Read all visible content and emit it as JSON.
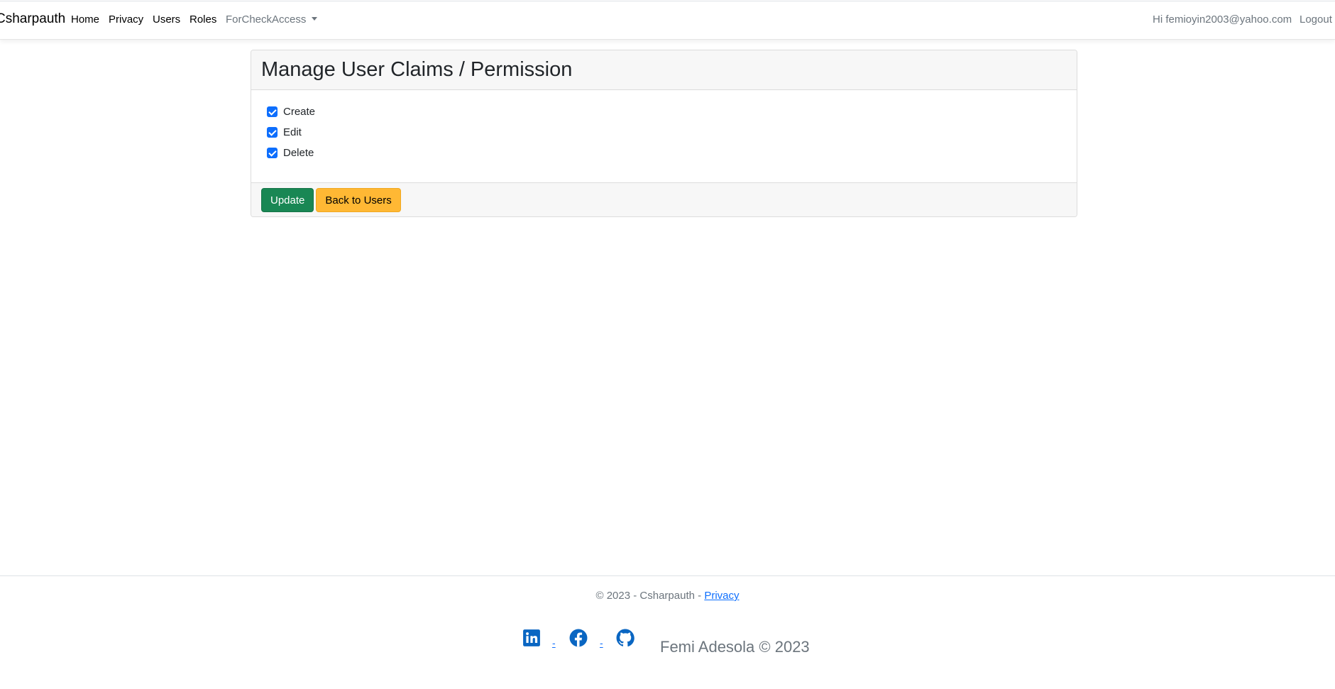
{
  "navbar": {
    "brand": "Csharpauth",
    "links": [
      "Home",
      "Privacy",
      "Users",
      "Roles"
    ],
    "dropdown_label": "ForCheckAccess",
    "greeting": "Hi femioyin2003@yahoo.com",
    "logout": "Logout"
  },
  "card": {
    "title": "Manage User Claims / Permission",
    "claims": [
      {
        "label": "Create",
        "checked": true
      },
      {
        "label": "Edit",
        "checked": true
      },
      {
        "label": "Delete",
        "checked": true
      }
    ],
    "update_label": "Update",
    "back_label": "Back to Users"
  },
  "footer": {
    "copyright_prefix": "© 2023 - Csharpauth - ",
    "privacy_link": "Privacy",
    "separator_1": "-",
    "separator_2": "-",
    "signature": "Femi Adesola © 2023",
    "social_icons": [
      "linkedin-icon",
      "facebook-icon",
      "github-icon"
    ]
  },
  "colors": {
    "primary": "#0d6efd",
    "success": "#198754",
    "warning": "#ffb834",
    "muted": "#6c757d"
  }
}
